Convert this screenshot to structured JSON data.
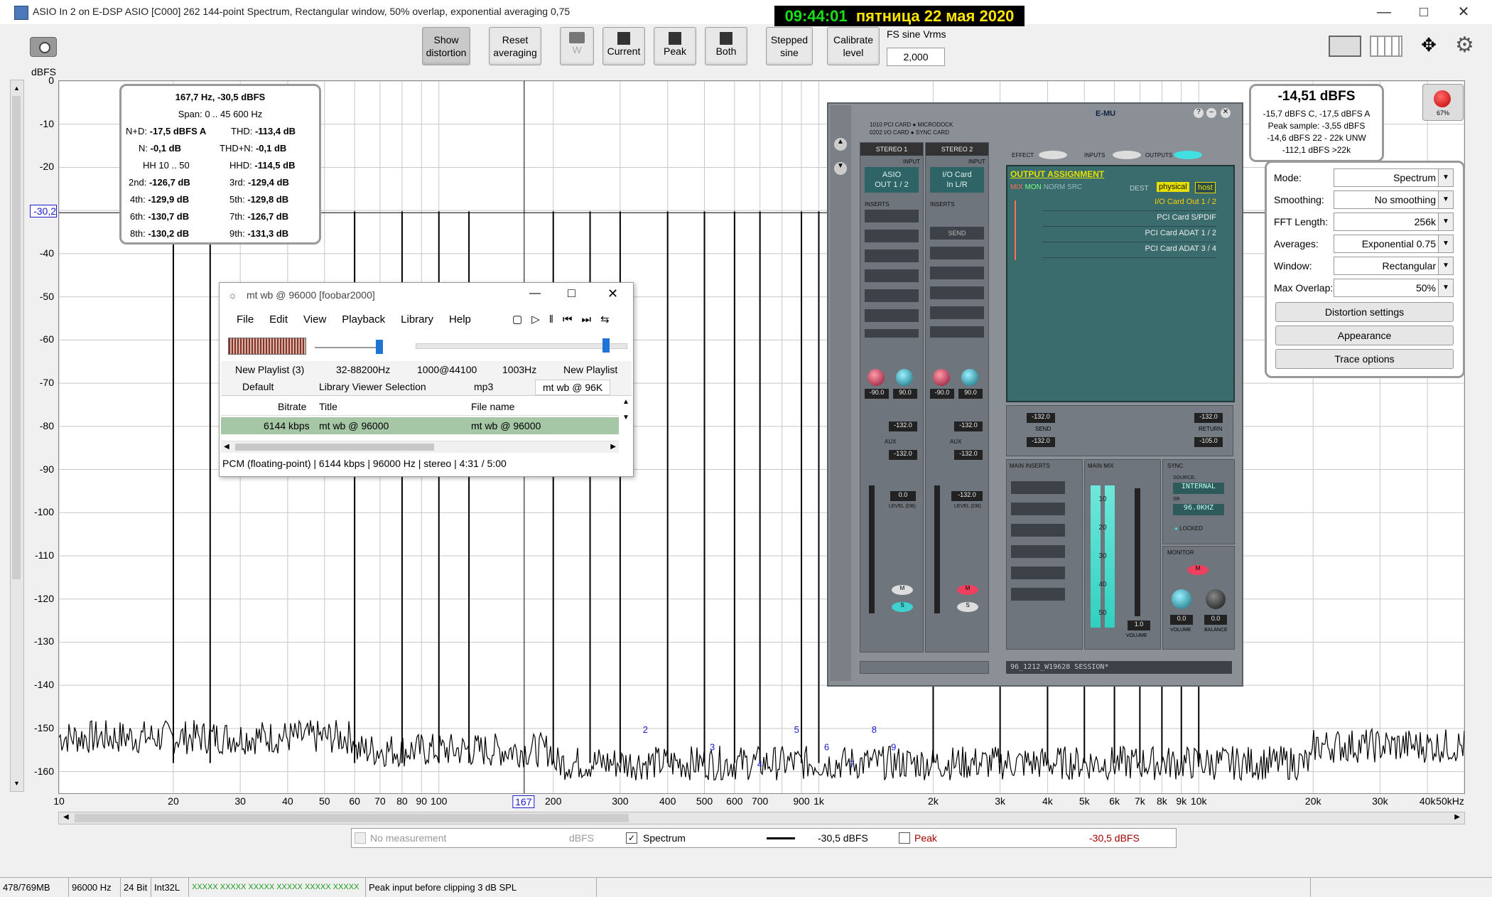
{
  "window": {
    "title": "ASIO In 2 on E-DSP ASIO [C000] 262 144-point Spectrum, Rectangular window, 50% overlap, exponential averaging 0,75",
    "clock_time": "09:44:01",
    "clock_date": "пятница 22 мая 2020"
  },
  "toolbar": {
    "show_distortion": [
      "Show",
      "distortion"
    ],
    "reset_averaging": [
      "Reset",
      "averaging"
    ],
    "w": "W",
    "current": "Current",
    "peak": "Peak",
    "both": "Both",
    "stepped_sine": [
      "Stepped",
      "sine"
    ],
    "calibrate_level": [
      "Calibrate",
      "level"
    ],
    "fs_label": "FS sine Vrms",
    "fs_value": "2,000"
  },
  "plot": {
    "ylabel": "dBFS",
    "y_ticks": [
      "0",
      "-10",
      "-20",
      "-30,2",
      "-40",
      "-50",
      "-60",
      "-70",
      "-80",
      "-90",
      "-100",
      "-110",
      "-120",
      "-130",
      "-140",
      "-150",
      "-160"
    ],
    "x_ticks": [
      "10",
      "20",
      "30",
      "40",
      "50",
      "60",
      "70",
      "80",
      "90",
      "100",
      "167",
      "200",
      "300",
      "400",
      "500",
      "600",
      "700",
      "900",
      "1k",
      "2k",
      "3k",
      "4k",
      "5k",
      "6k",
      "7k",
      "8k",
      "9k",
      "10k",
      "20k",
      "30k",
      "40k",
      "50kHz"
    ],
    "harmonic_markers": [
      "2",
      "3",
      "4",
      "5",
      "6",
      "7",
      "8",
      "9"
    ]
  },
  "chart_data": {
    "type": "line",
    "title": "",
    "xlabel": "",
    "ylabel": "dBFS",
    "x_scale": "log",
    "xlim": [
      10,
      50000
    ],
    "ylim": [
      -165,
      0
    ],
    "fundamental": {
      "freq_hz": 167.7,
      "level_dbfs": -30.5
    },
    "spur_lines_hz": [
      20,
      25,
      60,
      80,
      100,
      120,
      200,
      250,
      300,
      400,
      500,
      600,
      700,
      900,
      1000,
      2000,
      3000,
      4000,
      5000,
      6000,
      7000,
      8000,
      9000,
      10000
    ],
    "noise_floor_dbfs": -158,
    "grid": true
  },
  "readout": {
    "header": "167,7 Hz, -30,5 dBFS",
    "span": "Span: 0 .. 45 600 Hz",
    "nd_label": "N+D:",
    "nd_val": "-17,5 dBFS A",
    "thd_label": "THD:",
    "thd_val": "-113,4 dB",
    "n_label": "N:",
    "n_val": "-0,1 dB",
    "thdn_label": "THD+N:",
    "thdn_val": "-0,1 dB",
    "hh_label": "HH 10 .. 50",
    "hhd_label": "HHD:",
    "hhd_val": "-114,5 dB",
    "h2_label": "2nd:",
    "h2_val": "-126,7 dB",
    "h3_label": "3rd:",
    "h3_val": "-129,4 dB",
    "h4_label": "4th:",
    "h4_val": "-129,9 dB",
    "h5_label": "5th:",
    "h5_val": "-129,8 dB",
    "h6_label": "6th:",
    "h6_val": "-130,7 dB",
    "h7_label": "7th:",
    "h7_val": "-126,7 dB",
    "h8_label": "8th:",
    "h8_val": "-130,2 dB",
    "h9_label": "9th:",
    "h9_val": "-131,3 dB"
  },
  "level_box": {
    "main": "-14,51 dBFS",
    "line1": "-15,7 dBFS C, -17,5 dBFS A",
    "line2": "Peak sample: -3,55 dBFS",
    "line3": "-14,6 dBFS 22 - 22k UNW",
    "line4": "-112,1 dBFS >22k",
    "record_pct": "67%"
  },
  "settings": {
    "mode_label": "Mode:",
    "mode_val": "Spectrum",
    "smoothing_label": "Smoothing:",
    "smoothing_val": "No  smoothing",
    "fft_label": "FFT Length:",
    "fft_val": "256k",
    "avg_label": "Averages:",
    "avg_val": "Exponential 0.75",
    "window_label": "Window:",
    "window_val": "Rectangular",
    "overlap_label": "Max Overlap:",
    "overlap_val": "50%",
    "distortion_btn": "Distortion settings",
    "appearance_btn": "Appearance",
    "trace_btn": "Trace options"
  },
  "foobar": {
    "title": "mt wb @ 96000  [foobar2000]",
    "menu": [
      "File",
      "Edit",
      "View",
      "Playback",
      "Library",
      "Help"
    ],
    "tabs_row1": [
      "New Playlist (3)",
      "32-88200Hz",
      "1000@44100",
      "1003Hz",
      "New Playlist"
    ],
    "tabs_row2": [
      "Default",
      "Library Viewer Selection",
      "mp3",
      "mt wb @ 96K"
    ],
    "col_bitrate": "Bitrate",
    "col_title": "Title",
    "col_filename": "File name",
    "row_bitrate": "6144 kbps",
    "row_title": "mt wb @ 96000",
    "row_filename": "mt wb @ 96000",
    "status": "PCM (floating-point) | 6144 kbps | 96000 Hz | stereo | 4:31 / 5:00"
  },
  "emu": {
    "brand": "E-MU",
    "card1": "1010 PCI CARD",
    "card2": "0202 I/O CARD",
    "dock": "MICRODOCK",
    "sync_card": "SYNC CARD",
    "stereo1": "STEREO  1",
    "stereo2": "STEREO  2",
    "input": "INPUT",
    "asio": [
      "ASIO",
      "OUT 1 / 2"
    ],
    "io_card": [
      "I/O Card",
      "In L/R"
    ],
    "inserts": "INSERTS",
    "send": "SEND",
    "effect": "EFFECT",
    "inputs": "INPUTS",
    "outputs": "OUTPUTS",
    "output_assignment": "OUTPUT ASSIGNMENT",
    "mix": "MIX",
    "mon": "MON",
    "norm_src": "NORM SRC",
    "dest": "DEST",
    "physical": "physical",
    "host": "host",
    "outputs_list": [
      "I/O Card Out 1 / 2",
      "PCI Card S/PDIF",
      "PCI Card ADAT 1 / 2",
      "PCI Card ADAT 3 / 4"
    ],
    "pan_vals": [
      "-90.0",
      "90.0",
      "-90.0",
      "90.0"
    ],
    "pan_labels": [
      "PAN L",
      "PAN R",
      "PAN L",
      "PAN R"
    ],
    "aux": "AUX",
    "send_lbl": "SEND",
    "return_lbl": "RETURN",
    "aux_vals": [
      "-132.0",
      "-132.0",
      "-132.0",
      "-132.0"
    ],
    "send_vals": [
      "-132.0",
      "-132.0"
    ],
    "return_vals": [
      "-132.0",
      "-105.0"
    ],
    "level_vals": [
      "0.0",
      "-132.0"
    ],
    "level_label": "LEVEL (DB)",
    "main_inserts": "MAIN INSERTS",
    "main_mix": "MAIN MIX",
    "sync": "SYNC",
    "source": "SOURCE:",
    "source_val": "INTERNAL",
    "sr": "SR",
    "sr_val": "96.0KHZ",
    "locked": "LOCKED",
    "monitor": "MONITOR",
    "volume": "VOLUME",
    "balance": "BALANCE",
    "vol_val": "0.0",
    "bal_val": "0.0",
    "mix_vol": "1.0",
    "meter_ticks": [
      "10",
      "20",
      "30",
      "40",
      "50"
    ],
    "session": "96_1212_W19628 SESSION*"
  },
  "legend": {
    "no_measurement": "No measurement",
    "dbfs": "dBFS",
    "spectrum": "Spectrum",
    "spectrum_val": "-30,5 dBFS",
    "peak": "Peak",
    "peak_val": "-30,5 dBFS"
  },
  "status": {
    "memory": "478/769MB",
    "rate": "96000 Hz",
    "bits": "24 Bit",
    "format": "Int32L",
    "meters": "XXXXX XXXXX  XXXXX XXXXX  XXXXX XXXXX",
    "message": "Peak input before clipping 3 dB SPL"
  },
  "colors": {
    "clock_bg": "#000000",
    "clock_time": "#18e018",
    "clock_date": "#ffe500",
    "plot_bg": "#ffffff",
    "trace": "#000000",
    "peak_label": "#a00000",
    "emu_panel": "#8a9096",
    "emu_screen": "#3a6c6e",
    "emu_accent": "#e6e000",
    "foobar_row": "#a6c7a6"
  }
}
